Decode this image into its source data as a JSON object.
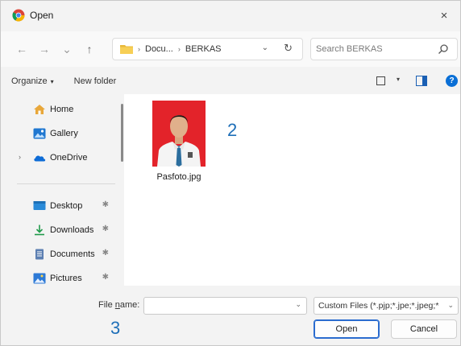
{
  "window": {
    "title": "Open",
    "close_glyph": "×"
  },
  "nav_buttons": {
    "back": "←",
    "forward": "→",
    "recent": "⌄",
    "up": "↑"
  },
  "address": {
    "crumbs": [
      "Docu...",
      "BERKAS"
    ],
    "separator": "›",
    "dropdown_glyph": "⌄",
    "refresh_glyph": "↻"
  },
  "search": {
    "placeholder": "Search BERKAS"
  },
  "commandbar": {
    "organize_label": "Organize",
    "organize_caret": "▾",
    "new_folder_label": "New folder",
    "view_caret": "▾",
    "help_glyph": "?"
  },
  "navpane": {
    "items": [
      {
        "label": "Home",
        "icon": "home-icon"
      },
      {
        "label": "Gallery",
        "icon": "gallery-icon"
      },
      {
        "label": "OneDrive",
        "icon": "onedrive-icon",
        "expander": "›"
      },
      {
        "label": "Desktop",
        "icon": "desktop-icon",
        "pinned": true
      },
      {
        "label": "Downloads",
        "icon": "downloads-icon",
        "pinned": true
      },
      {
        "label": "Documents",
        "icon": "documents-icon",
        "pinned": true
      },
      {
        "label": "Pictures",
        "icon": "pictures-icon",
        "pinned": true
      }
    ],
    "pin_glyph": "✱"
  },
  "files": [
    {
      "name": "Pasfoto.jpg",
      "icon": "photo-thumbnail"
    }
  ],
  "annotations": {
    "marker_files": "2",
    "marker_filename": "3"
  },
  "bottom": {
    "file_name_prefix": "File ",
    "file_name_underlined": "n",
    "file_name_suffix": "ame:",
    "file_name_value": "",
    "filter_value": "Custom Files (*.pjp;*.jpe;*.jpeg;*",
    "dropdown_glyph": "⌄",
    "open_label": "Open",
    "cancel_label": "Cancel"
  },
  "colors": {
    "accent": "#0a6fd6",
    "annotation": "#1e6fb8",
    "photo_background": "#e3232a"
  }
}
